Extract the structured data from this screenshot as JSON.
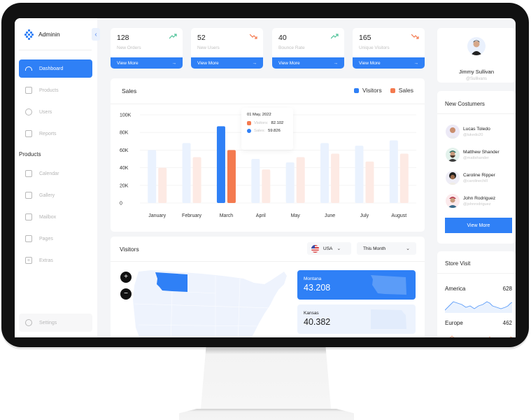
{
  "app": {
    "name": "Adminin",
    "collapse_icon": "chevron-left"
  },
  "sidebar": {
    "items": [
      {
        "label": "Dashboard",
        "icon": "gauge-icon",
        "active": true
      },
      {
        "label": "Products",
        "icon": "basket-icon",
        "active": false
      },
      {
        "label": "Users",
        "icon": "user-circle-icon",
        "active": false
      },
      {
        "label": "Reports",
        "icon": "clipboard-icon",
        "active": false
      }
    ],
    "section_label": "Products",
    "section_items": [
      {
        "label": "Calendar",
        "icon": "calendar-icon"
      },
      {
        "label": "Gallery",
        "icon": "image-icon"
      },
      {
        "label": "Mailbox",
        "icon": "inbox-icon"
      },
      {
        "label": "Pages",
        "icon": "pages-icon"
      },
      {
        "label": "Extras",
        "icon": "plus-square-icon"
      }
    ],
    "settings_label": "Settings"
  },
  "kpis": [
    {
      "value": "128",
      "label": "New Orders",
      "trend": "up",
      "button": "View More"
    },
    {
      "value": "52",
      "label": "New Users",
      "trend": "down",
      "button": "View More"
    },
    {
      "value": "40",
      "label": "Bounce Rate",
      "trend": "up",
      "button": "View More"
    },
    {
      "value": "165",
      "label": "Unique Visitors",
      "trend": "down",
      "button": "View More"
    }
  ],
  "colors": {
    "primary": "#2f80f6",
    "sales": "#f47a4f",
    "visitors_faded": "#eaf2fe",
    "sales_faded": "#fdeae4",
    "trend_up": "#4fc39a",
    "trend_down": "#f47a4f"
  },
  "sales_card": {
    "title": "Sales",
    "legend": [
      "Visitors",
      "Sales"
    ],
    "tooltip": {
      "date": "01 May, 2022",
      "rows": [
        {
          "label": "Visitors:",
          "value": "82.102"
        },
        {
          "label": "Sales:",
          "value": "59.826"
        }
      ]
    }
  },
  "chart_data": {
    "type": "bar",
    "title": "Sales",
    "categories": [
      "January",
      "February",
      "March",
      "April",
      "May",
      "June",
      "July",
      "August"
    ],
    "series": [
      {
        "name": "Visitors",
        "values": [
          60000,
          68000,
          87000,
          50000,
          46000,
          68000,
          65000,
          71000
        ]
      },
      {
        "name": "Sales",
        "values": [
          40000,
          52000,
          60000,
          38000,
          52000,
          56000,
          47000,
          56000
        ]
      }
    ],
    "highlighted_category": "March",
    "y_ticks": [
      "0",
      "20K",
      "40K",
      "60K",
      "80K",
      "100K"
    ],
    "ylim": [
      0,
      100000
    ],
    "xlabel": "",
    "ylabel": "",
    "grid": true,
    "legend_position": "top-right"
  },
  "visitors_card": {
    "title": "Visitors",
    "country": "USA",
    "period": "This Month",
    "zoom_in": "+",
    "zoom_out": "−",
    "states": [
      {
        "name": "Montana",
        "value": "43.208"
      },
      {
        "name": "Kansas",
        "value": "40.382"
      }
    ]
  },
  "profile": {
    "name": "Jimmy Sullivan",
    "handle": "@Sullivans"
  },
  "customers": {
    "title": "New Costumers",
    "list": [
      {
        "name": "Lucas Toledo",
        "handle": "@lukedo20"
      },
      {
        "name": "Matthew Shander",
        "handle": "@mattshander"
      },
      {
        "name": "Caroline Ripper",
        "handle": "@carolinechill"
      },
      {
        "name": "John Rodriguez",
        "handle": "@johnrodriguez"
      }
    ],
    "button": "View More"
  },
  "store_visit": {
    "title": "Store Visit",
    "regions": [
      {
        "name": "America",
        "value": "628"
      },
      {
        "name": "Europe",
        "value": "462"
      }
    ]
  }
}
